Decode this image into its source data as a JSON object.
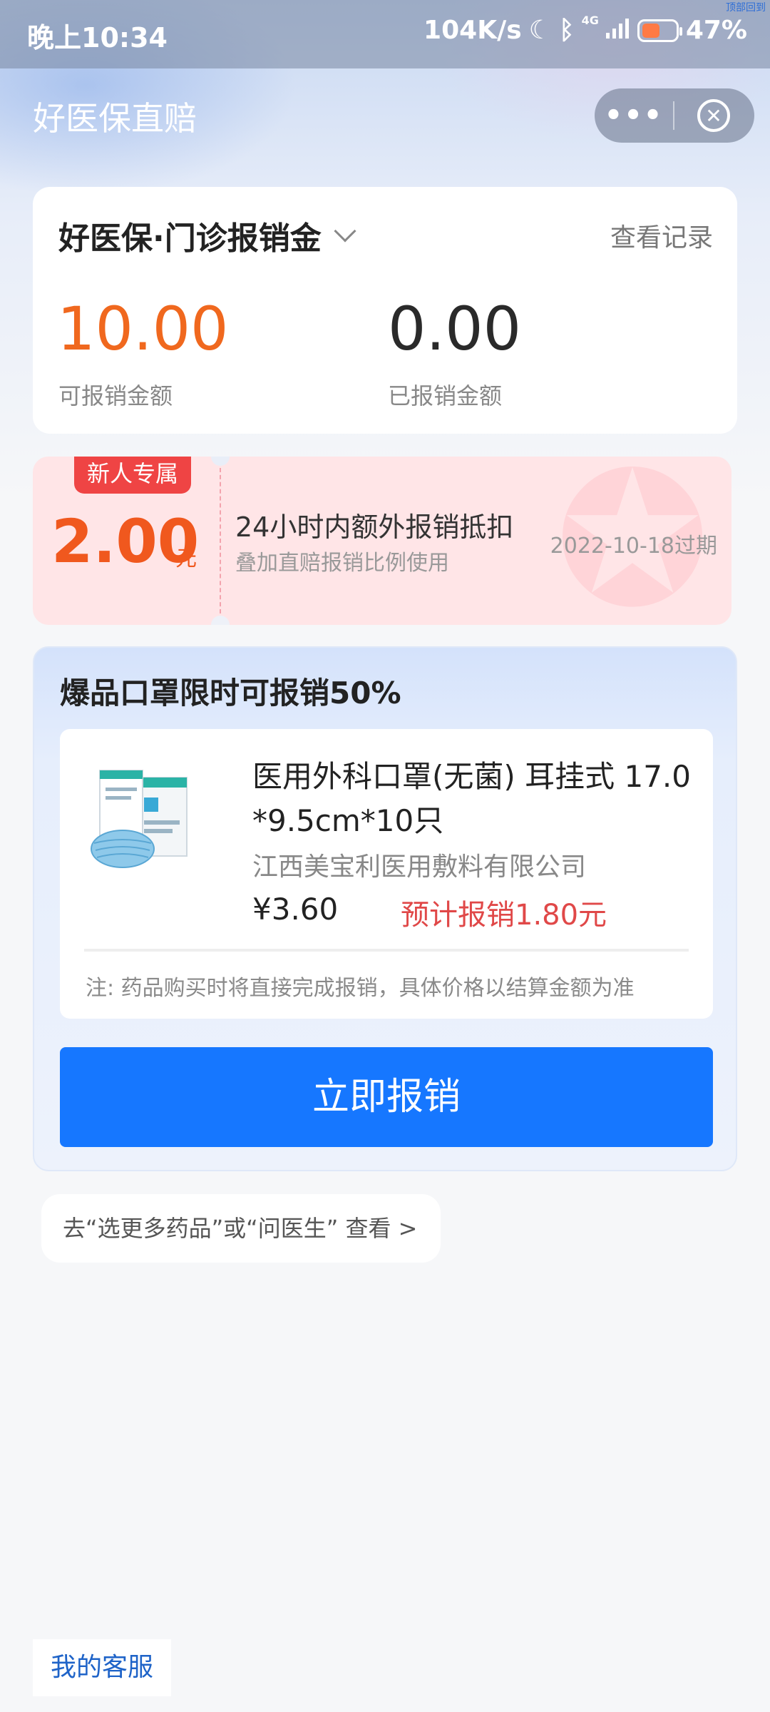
{
  "status_bar": {
    "time": "晚上10:34",
    "speed": "104K/s",
    "network": "4G",
    "battery": "47%",
    "watermark": "顶部回到"
  },
  "header": {
    "title": "好医保直赔",
    "more_label": "•••",
    "close_label": "✕"
  },
  "balance_card": {
    "title": "好医保·门诊报销金",
    "records_link": "查看记录",
    "available_amount": "10.00",
    "available_label": "可报销金额",
    "claimed_amount": "0.00",
    "claimed_label": "已报销金额"
  },
  "coupon": {
    "badge": "新人专属",
    "amount": "2.00",
    "unit": "元",
    "title": "24小时内额外报销抵扣",
    "subtitle": "叠加直赔报销比例使用",
    "expiry": "2022-10-18过期"
  },
  "promo": {
    "title": "爆品口罩限时可报销50%",
    "product": {
      "name": "医用外科口罩(无菌) 耳挂式 17.0 *9.5cm*10只",
      "manufacturer": "江西美宝利医用敷料有限公司",
      "price": "¥3.60",
      "estimated": "预计报销1.80元",
      "note": "注: 药品购买时将直接完成报销，具体价格以结算金额为准"
    },
    "cta_label": "立即报销"
  },
  "more_link": "去“选更多药品”或“问医生” 查看 >",
  "service_button": "我的客服",
  "colors": {
    "accent": "#1677ff",
    "orange": "#f0681e",
    "red": "#e04848",
    "badge": "#ef4444"
  }
}
